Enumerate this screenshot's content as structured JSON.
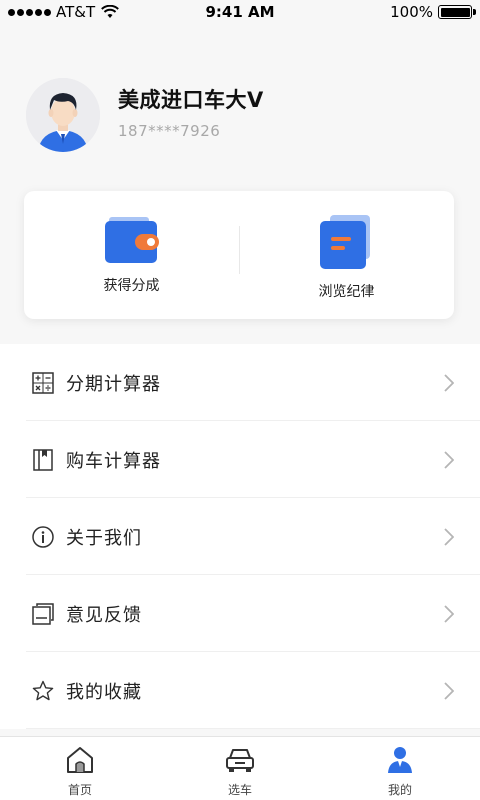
{
  "status_bar": {
    "carrier": "AT&T",
    "time": "9:41 AM",
    "battery": "100%",
    "battery_level": 1.0
  },
  "profile": {
    "name": "美成进口车大V",
    "phone": "187****7926"
  },
  "card": {
    "items": [
      {
        "label": "获得分成",
        "icon": "wallet-icon"
      },
      {
        "label": "浏览纪律",
        "icon": "document-icon"
      }
    ]
  },
  "menu": {
    "items": [
      {
        "label": "分期计算器",
        "icon": "calculator-icon"
      },
      {
        "label": "购车计算器",
        "icon": "book-icon"
      },
      {
        "label": "关于我们",
        "icon": "info-icon"
      },
      {
        "label": "意见反馈",
        "icon": "feedback-icon"
      },
      {
        "label": "我的收藏",
        "icon": "star-icon"
      }
    ]
  },
  "tabbar": {
    "tabs": [
      {
        "label": "首页",
        "icon": "home-icon",
        "active": false
      },
      {
        "label": "选车",
        "icon": "car-icon",
        "active": false
      },
      {
        "label": "我的",
        "icon": "user-icon",
        "active": true
      }
    ]
  },
  "colors": {
    "accent_blue": "#2f6fe4",
    "accent_orange": "#f07a3a",
    "background": "#f7f7f7",
    "text_primary": "#222222",
    "text_secondary": "#a8a8a8"
  }
}
